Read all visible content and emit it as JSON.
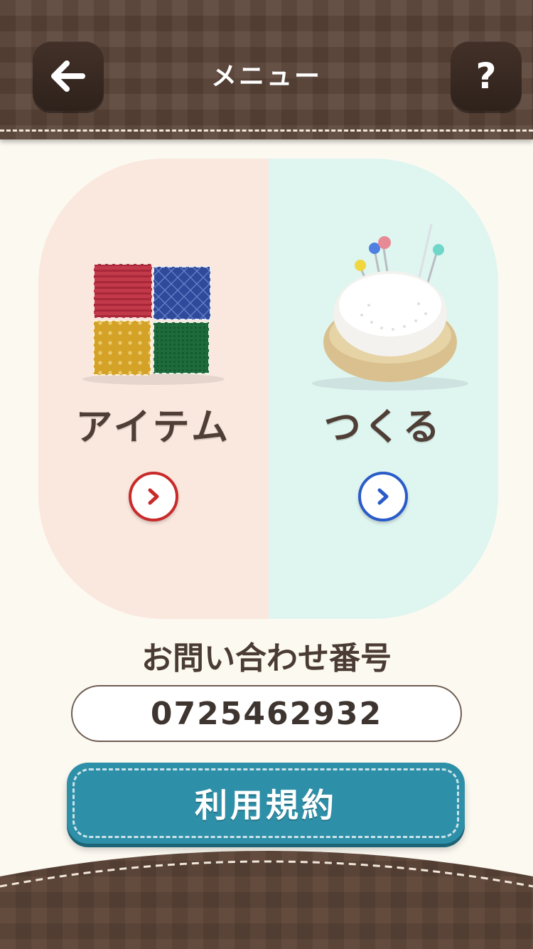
{
  "header": {
    "title": "メニュー",
    "back_icon": "arrow-left-icon",
    "help_label": "?"
  },
  "menu": {
    "item": {
      "label": "アイテム",
      "icon": "fabric-patches-icon",
      "go_icon": "chevron-right-icon",
      "accent": "#c92a2a"
    },
    "make": {
      "label": "つくる",
      "icon": "pincushion-icon",
      "go_icon": "chevron-right-icon",
      "accent": "#2a5bc9"
    }
  },
  "inquiry": {
    "label": "お問い合わせ番号",
    "number": "0725462932"
  },
  "terms": {
    "label": "利用規約",
    "color": "#2e8fa8"
  },
  "colors": {
    "header_bg": "#5a4438",
    "page_bg": "#fcf9f1",
    "item_panel": "#fae8de",
    "make_panel": "#def5f0"
  }
}
